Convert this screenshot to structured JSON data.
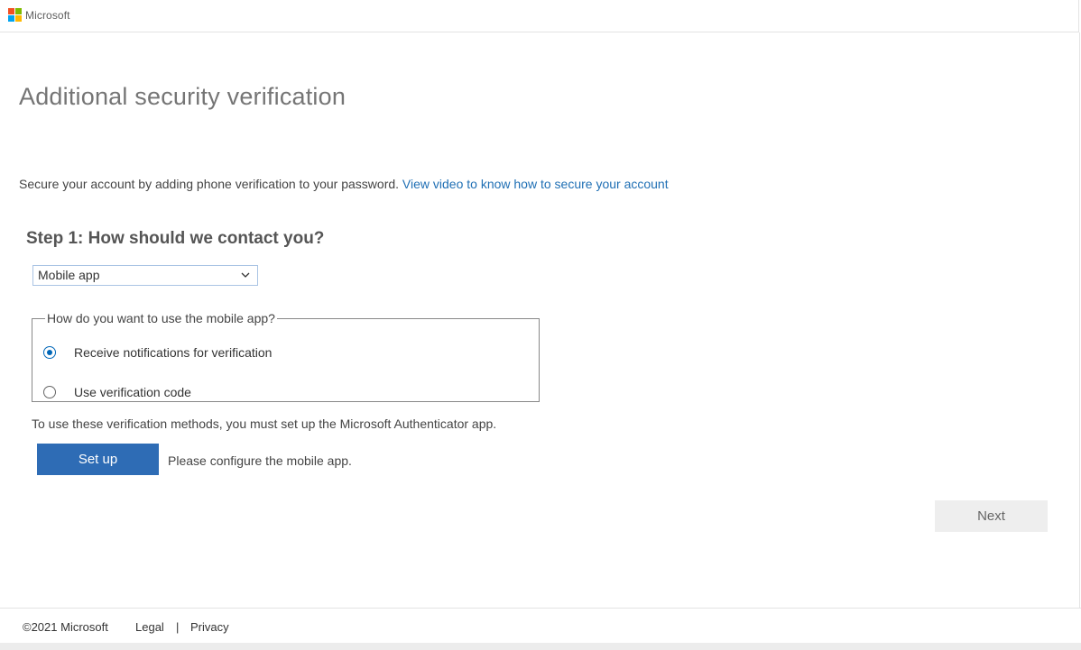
{
  "header": {
    "brand": "Microsoft",
    "logo_colors": [
      "#f25022",
      "#7fba00",
      "#00a4ef",
      "#ffb900"
    ]
  },
  "main": {
    "title": "Additional security verification",
    "intro_text": "Secure your account by adding phone verification to your password.",
    "intro_link": "View video to know how to secure your account",
    "step_title": "Step 1: How should we contact you?",
    "contact_method": {
      "selected": "Mobile app"
    },
    "mobile_app_usage": {
      "legend": "How do you want to use the mobile app?",
      "options": [
        {
          "label": "Receive notifications for verification",
          "checked": true
        },
        {
          "label": "Use verification code",
          "checked": false
        }
      ]
    },
    "note": "To use these verification methods, you must set up the Microsoft Authenticator app.",
    "setup_button": "Set up",
    "setup_status": "Please configure the mobile app.",
    "next_button": "Next"
  },
  "footer": {
    "copyright": "©2021 Microsoft",
    "legal": "Legal",
    "separator": "|",
    "privacy": "Privacy"
  },
  "colors": {
    "accent": "#2e6cb5",
    "link": "#1f6fb4",
    "radio_checked": "#0067b8"
  }
}
